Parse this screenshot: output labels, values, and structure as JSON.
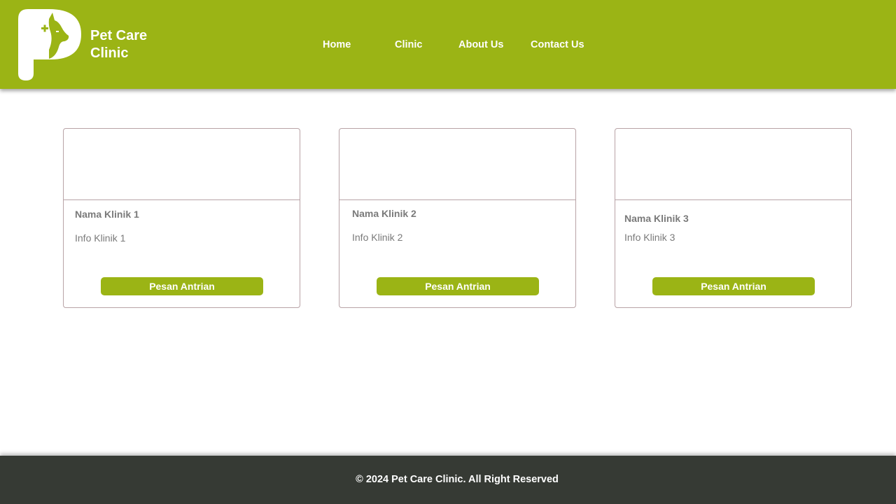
{
  "header": {
    "brand_line1": "Pet Care",
    "brand_line2": "Clinic",
    "logo_icon": "pet-care-logo-icon",
    "background_color": "#9bb415"
  },
  "nav": {
    "items": [
      {
        "label": "Home"
      },
      {
        "label": "Clinic"
      },
      {
        "label": "About Us"
      },
      {
        "label": "Contact Us"
      }
    ]
  },
  "clinics": [
    {
      "name": "Nama Klinik 1",
      "info": "Info Klinik 1",
      "button_label": "Pesan Antrian"
    },
    {
      "name": "Nama Klinik 2",
      "info": "Info Klinik 2",
      "button_label": "Pesan Antrian"
    },
    {
      "name": "Nama Klinik 3",
      "info": "Info Klinik 3",
      "button_label": "Pesan Antrian"
    }
  ],
  "footer": {
    "copyright": "© 2024 Pet Care Clinic. All Right Reserved",
    "background_color": "#363a34"
  },
  "colors": {
    "accent": "#9bb415",
    "card_border": "#b8a3a6",
    "muted_text": "#7a7a7a"
  }
}
